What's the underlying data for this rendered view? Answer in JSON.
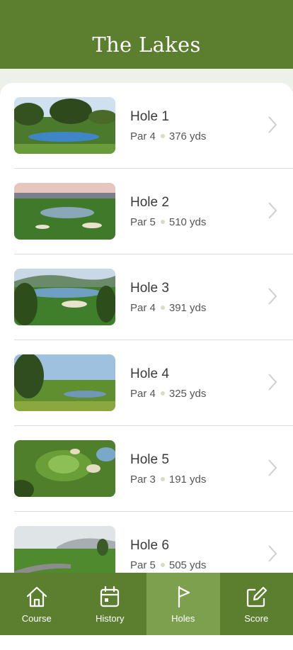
{
  "header": {
    "title": "The Lakes"
  },
  "holes": [
    {
      "name": "Hole 1",
      "par": "Par 4",
      "distance": "376 yds"
    },
    {
      "name": "Hole 2",
      "par": "Par 5",
      "distance": "510 yds"
    },
    {
      "name": "Hole 3",
      "par": "Par 4",
      "distance": "391 yds"
    },
    {
      "name": "Hole 4",
      "par": "Par 4",
      "distance": "325 yds"
    },
    {
      "name": "Hole 5",
      "par": "Par 3",
      "distance": "191 yds"
    },
    {
      "name": "Hole 6",
      "par": "Par 5",
      "distance": "505 yds"
    }
  ],
  "tabs": [
    {
      "label": "Course",
      "icon": "home-icon",
      "active": false
    },
    {
      "label": "History",
      "icon": "calendar-icon",
      "active": false
    },
    {
      "label": "Holes",
      "icon": "flag-icon",
      "active": true
    },
    {
      "label": "Score",
      "icon": "edit-icon",
      "active": false
    }
  ],
  "colors": {
    "brand": "#5b7f2f",
    "active_tab": "#7ca04d"
  }
}
